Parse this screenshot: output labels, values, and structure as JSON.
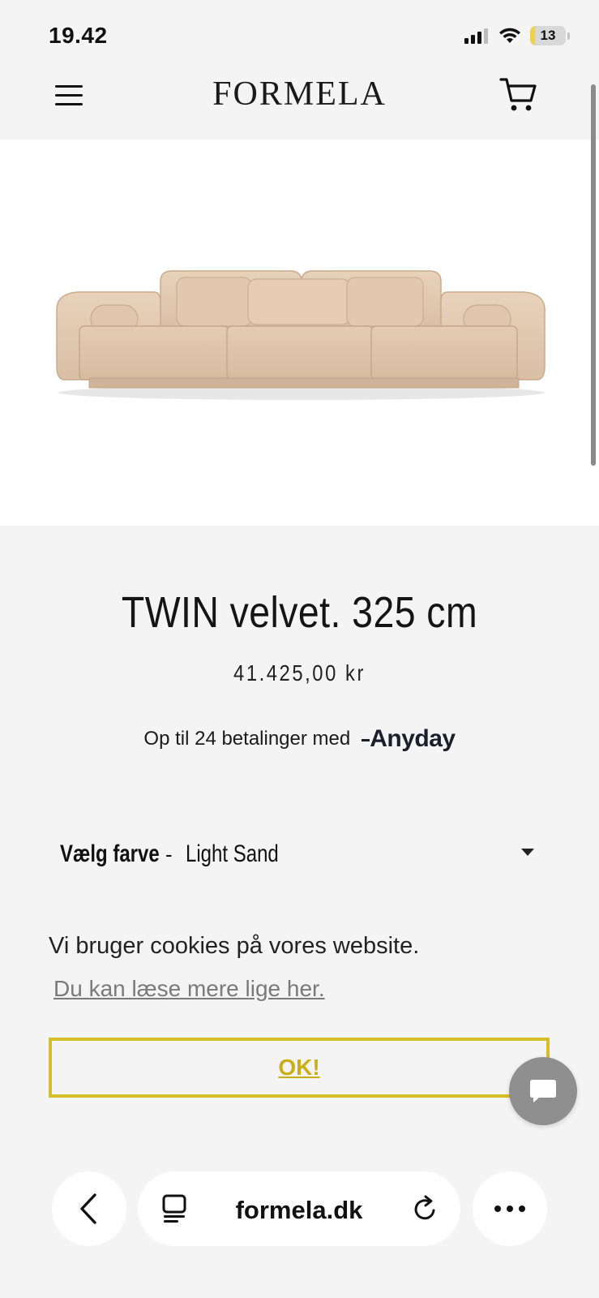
{
  "status_bar": {
    "time": "19.42",
    "battery_percent": 13,
    "battery_color": "#f0d24a",
    "icons": [
      "signal-icon",
      "wifi-icon",
      "battery-icon"
    ]
  },
  "header": {
    "logo": "FORMELA",
    "menu_icon": "hamburger-menu-icon",
    "cart_icon": "shopping-cart-icon"
  },
  "product": {
    "image": "beige-velvet-sofa-image",
    "title": "TWIN velvet. 325 cm",
    "price": "41.425,00 kr",
    "installment_text": "Op til 24 betalinger med",
    "installment_provider": "Anyday"
  },
  "variant": {
    "label": "Vælg farve",
    "separator": "-",
    "selected": "Light Sand"
  },
  "cookie_banner": {
    "message": "Vi bruger cookies på vores website.",
    "link_text": "Du kan læse mere lige her.",
    "button_label": "OK!",
    "accent_color": "#d6bd2a"
  },
  "chat": {
    "icon": "chat-bubble-icon"
  },
  "browser": {
    "url": "formela.dk",
    "icons": [
      "back-arrow-icon",
      "tab-overview-icon",
      "reload-icon",
      "more-icon"
    ]
  }
}
